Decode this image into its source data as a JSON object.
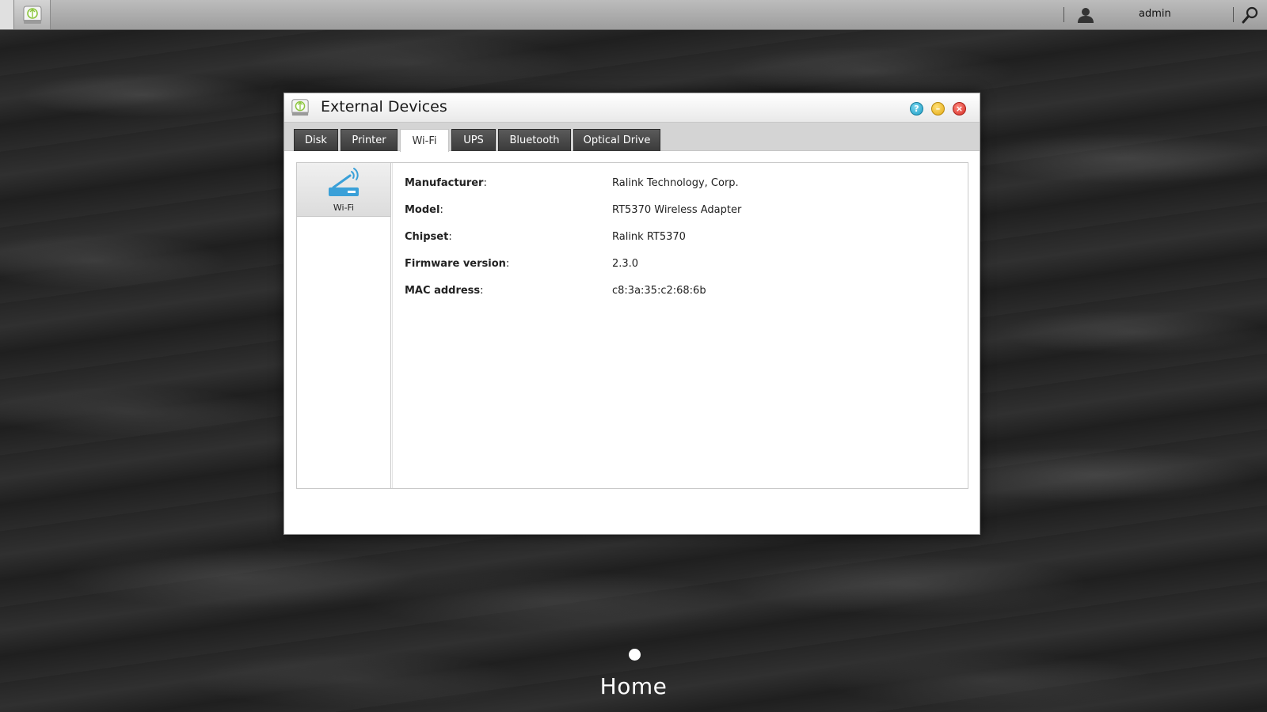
{
  "topbar": {
    "user_name": "admin"
  },
  "window": {
    "title": "External Devices",
    "tabs": [
      {
        "label": "Disk"
      },
      {
        "label": "Printer"
      },
      {
        "label": "Wi-Fi"
      },
      {
        "label": "UPS"
      },
      {
        "label": "Bluetooth"
      },
      {
        "label": "Optical Drive"
      }
    ],
    "sidebar": {
      "items": [
        {
          "label": "Wi-Fi"
        }
      ]
    },
    "details": [
      {
        "key": "Manufacturer",
        "value": "Ralink Technology, Corp."
      },
      {
        "key": "Model",
        "value": "RT5370 Wireless Adapter"
      },
      {
        "key": "Chipset",
        "value": "Ralink RT5370"
      },
      {
        "key": "Firmware version",
        "value": "2.3.0"
      },
      {
        "key": "MAC address",
        "value": "c8:3a:35:c2:68:6b"
      }
    ]
  },
  "desktop": {
    "page_label": "Home"
  },
  "colors": {
    "accent_blue": "#3aa0d8",
    "help": "#1a9cc4",
    "minimize": "#e4a810",
    "close": "#d52a22"
  }
}
